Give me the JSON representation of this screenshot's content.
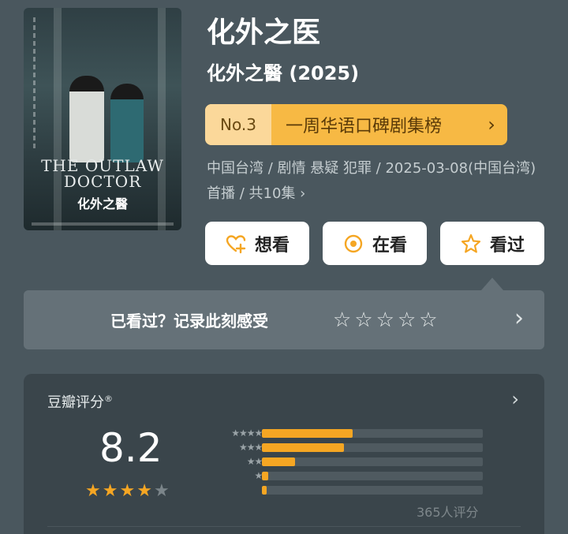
{
  "show": {
    "title": "化外之医",
    "subtitle": "化外之醫 (2025)",
    "poster": {
      "en_title": "THE OUTLAW DOCTOR",
      "cn_title": "化外之醫"
    }
  },
  "ranking": {
    "number": "No.3",
    "label": "一周华语口碑剧集榜",
    "chevron": "›"
  },
  "meta": {
    "text": "中国台湾 / 剧情 悬疑 犯罪 / 2025-03-08(中国台湾)首播 / 共10集 ›"
  },
  "actions": {
    "want": {
      "label": "想看",
      "icon": "heart-plus-icon"
    },
    "watching": {
      "label": "在看",
      "icon": "target-icon"
    },
    "watched": {
      "label": "看过",
      "icon": "star-outline-icon"
    }
  },
  "record": {
    "prompt": "已看过？记录此刻感受",
    "stars": [
      "☆",
      "☆",
      "☆",
      "☆",
      "☆"
    ],
    "chevron": "›"
  },
  "rating": {
    "label": "豆瓣评分",
    "trademark": "®",
    "score": "8.2",
    "stars_filled": 4,
    "stars_total": 5,
    "distribution": [
      {
        "stars": "★★★★★",
        "fraction": 0.41
      },
      {
        "stars": "★★★★",
        "fraction": 0.37
      },
      {
        "stars": "★★★",
        "fraction": 0.15
      },
      {
        "stars": "★★",
        "fraction": 0.03
      },
      {
        "stars": "★",
        "fraction": 0.02
      }
    ],
    "count": "365人评分",
    "chevron": "›"
  },
  "colors": {
    "background": "#4a575e",
    "accent": "#f5a623",
    "rank_badge": "#f7b944",
    "card": "#3a454b"
  }
}
